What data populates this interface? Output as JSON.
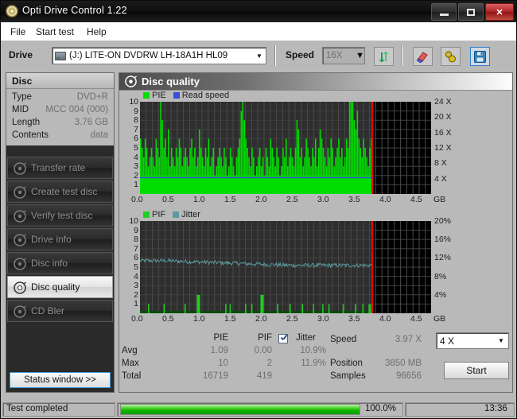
{
  "window": {
    "title": "Opti Drive Control 1.22",
    "icon": "disc-icon",
    "minimize": "–",
    "maximize": "□",
    "close": "✕"
  },
  "menu": {
    "items": [
      "File",
      "Start test",
      "Help"
    ]
  },
  "toolbar": {
    "drive_label": "Drive",
    "drive_value": "(J:)  LITE-ON DVDRW LH-18A1H HL09",
    "drive_arrow": "▼",
    "speed_label": "Speed",
    "speed_value": "16X",
    "speed_arrow": "▼",
    "refresh_icon": "refresh-arrows-icon",
    "erase_icon": "eraser-icon",
    "tools_icon": "tools-icon",
    "save_icon": "floppy-save-icon"
  },
  "sidebar": {
    "disc_header": "Disc",
    "info": [
      {
        "key": "Type",
        "value": "DVD+R"
      },
      {
        "key": "MID",
        "value": "MCC 004 (000)"
      },
      {
        "key": "Length",
        "value": "3.76 GB"
      },
      {
        "key": "Contents",
        "value": "data"
      }
    ],
    "nav": [
      {
        "label": "Transfer rate",
        "icon": "disc-icon",
        "active": false
      },
      {
        "label": "Create test disc",
        "icon": "disc-icon",
        "active": false
      },
      {
        "label": "Verify test disc",
        "icon": "disc-icon",
        "active": false
      },
      {
        "label": "Drive info",
        "icon": "disc-icon",
        "active": false
      },
      {
        "label": "Disc info",
        "icon": "disc-icon",
        "active": false
      },
      {
        "label": "Disc quality",
        "icon": "disc-icon",
        "active": true
      },
      {
        "label": "CD Bler",
        "icon": "disc-icon",
        "active": false
      }
    ],
    "status_window_button": "Status window >>"
  },
  "panel": {
    "title": "Disc quality",
    "icon": "disc-icon"
  },
  "stats": {
    "col_headers": [
      "PIE",
      "PIF",
      "Jitter"
    ],
    "row_headers": [
      "Avg",
      "Max",
      "Total"
    ],
    "pie": {
      "avg": "1.09",
      "max": "10",
      "total": "16719"
    },
    "pif": {
      "avg": "0.00",
      "max": "2",
      "total": "419"
    },
    "jitter": {
      "avg": "10.9%",
      "max": "11.9%",
      "total": ""
    },
    "jitter_checked": true,
    "speed_label": "Speed",
    "speed_value": "3.97 X",
    "position_label": "Position",
    "position_value": "3850 MB",
    "samples_label": "Samples",
    "samples_value": "96656",
    "speed_select_value": "4 X",
    "speed_select_arrow": "▼",
    "start_button": "Start"
  },
  "statusbar": {
    "message": "Test completed",
    "progress_text": "100.0%",
    "progress_percent": 100,
    "time": "13:36"
  },
  "colors": {
    "pie_green": "#00dd00",
    "read_speed_blue": "#3b4ad8",
    "pif_green": "#22cc22",
    "jitter_teal": "#5c9aa0",
    "marker_red": "#ee0000",
    "plot_bg": "#000000",
    "plot_grid": "#3a3a3a"
  },
  "chart_data": [
    {
      "type": "area",
      "name": "PIE / Read speed",
      "title": "Disc quality",
      "legend": [
        {
          "label": "PIE",
          "color": "#00dd00"
        },
        {
          "label": "Read speed",
          "color": "#3b4ad8"
        }
      ],
      "legend_position": "top-left",
      "xlabel": "GB",
      "ylabel": "PIE",
      "y2label": "Read speed",
      "xlim": [
        0.0,
        4.7
      ],
      "ylim": [
        0,
        10
      ],
      "y2lim": [
        0,
        24
      ],
      "xticks": [
        "0.0",
        "0.5",
        "1.0",
        "1.5",
        "2.0",
        "2.5",
        "3.0",
        "3.5",
        "4.0",
        "4.5"
      ],
      "yticks": [
        "1",
        "2",
        "3",
        "4",
        "5",
        "6",
        "7",
        "8",
        "9",
        "10"
      ],
      "y2ticks": [
        "4 X",
        "8 X",
        "12 X",
        "16 X",
        "20 X",
        "24 X"
      ],
      "grid": true,
      "data_end_gb": 3.76,
      "marker_gb": 3.76,
      "series": [
        {
          "name": "PIE",
          "color": "#00dd00",
          "kind": "bars",
          "baseline": 2,
          "values": [
            6,
            5,
            4,
            6,
            5,
            3,
            4,
            5,
            4,
            3,
            6,
            5,
            4,
            10,
            8,
            5,
            6,
            4,
            7,
            3,
            5,
            4,
            3,
            5,
            4,
            6,
            5,
            3,
            4,
            5,
            4,
            3,
            5,
            6,
            4,
            5,
            3,
            4,
            7,
            5,
            4,
            3,
            5,
            4,
            6,
            3,
            4,
            5,
            2,
            3,
            4,
            5,
            4,
            3,
            5,
            4,
            2,
            3,
            5,
            4,
            3,
            2,
            4,
            5,
            6,
            9,
            10,
            8,
            6,
            5,
            4,
            3,
            5,
            4,
            2,
            3,
            4,
            5,
            3,
            4,
            2,
            5,
            4,
            3,
            6,
            5,
            4,
            3,
            5,
            4,
            2,
            3,
            5,
            4,
            6,
            3,
            4,
            5,
            4,
            3,
            5,
            8,
            7,
            4,
            5,
            3,
            4,
            6,
            5,
            4,
            3,
            5,
            4,
            6,
            3,
            5,
            7,
            6,
            5,
            4,
            3,
            5,
            4,
            6,
            5,
            3,
            4,
            5,
            6,
            4,
            5,
            3,
            4,
            6,
            5,
            12,
            11,
            10,
            8,
            7,
            9,
            6,
            5,
            4,
            6,
            5,
            4,
            3,
            5,
            6
          ]
        },
        {
          "name": "Read speed",
          "color": "#3b4ad8",
          "kind": "line",
          "constant_x": 3.97
        }
      ]
    },
    {
      "type": "line",
      "name": "PIF / Jitter",
      "legend": [
        {
          "label": "PIF",
          "color": "#22cc22"
        },
        {
          "label": "Jitter",
          "color": "#5c9aa0"
        }
      ],
      "legend_position": "top-left",
      "xlabel": "GB",
      "ylabel": "PIF",
      "y2label": "Jitter",
      "xlim": [
        0.0,
        4.7
      ],
      "ylim": [
        0,
        10
      ],
      "y2lim": [
        0,
        20
      ],
      "xticks": [
        "0.0",
        "0.5",
        "1.0",
        "1.5",
        "2.0",
        "2.5",
        "3.0",
        "3.5",
        "4.0",
        "4.5"
      ],
      "yticks": [
        "1",
        "2",
        "3",
        "4",
        "5",
        "6",
        "7",
        "8",
        "9",
        "10"
      ],
      "y2ticks": [
        "4%",
        "8%",
        "12%",
        "16%",
        "20%"
      ],
      "grid": true,
      "data_end_gb": 3.76,
      "marker_gb": 3.76,
      "series": [
        {
          "name": "PIF",
          "color": "#22cc22",
          "kind": "spikes",
          "spikes_gb": [
            0.13,
            0.38,
            0.72,
            0.92,
            1.38,
            1.45,
            1.7,
            1.8,
            1.95,
            2.22,
            2.42,
            2.62,
            2.8,
            2.95,
            3.05,
            3.28,
            3.48,
            3.6,
            3.7
          ],
          "spike_heights": [
            1,
            1,
            1,
            2,
            1,
            1,
            1,
            1,
            2,
            1,
            1,
            1,
            1,
            1,
            1,
            1,
            1,
            1,
            1
          ]
        },
        {
          "name": "Jitter",
          "color": "#5c9aa0",
          "kind": "line",
          "avg_percent": 10.9,
          "max_percent": 11.9,
          "approx_band_percent": [
            11.4,
            10.4
          ]
        }
      ]
    }
  ]
}
